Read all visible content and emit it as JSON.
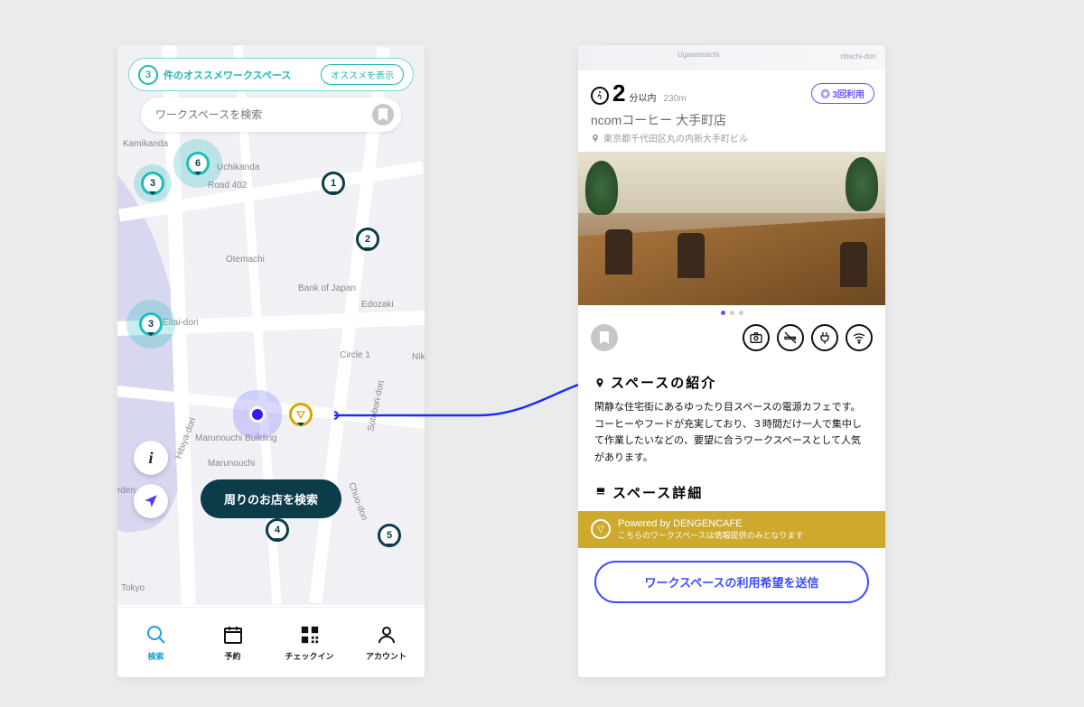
{
  "left": {
    "recommend": {
      "count": "3",
      "label": "件のオススメワークスペース",
      "show": "オススメを表示"
    },
    "search_placeholder": "ワークスペースを検索",
    "map_labels": {
      "uchikanda": "Uchikanda",
      "road402": "Road 402",
      "otemachi": "Otemachi",
      "bankjp": "Bank of Japan",
      "edozaki": "Edozaki",
      "eitai": "Eitai-dori",
      "circle1": "Circle 1",
      "marunouchi": "Marunouchi",
      "building": "Marunouchi Building",
      "chuo": "Chuo-dori",
      "hibiya": "Hibiya-dori",
      "nik": "Nik",
      "sotobori": "Sotobori-dori",
      "tokyo": "Tokyo",
      "garden": "rden",
      "ugawa": "Ugawamachi",
      "kanda": "Kamikanda"
    },
    "pins": {
      "p1": "3",
      "p2": "6",
      "p3": "1",
      "p4": "2",
      "p5": "3",
      "p6": "4",
      "p7": "5"
    },
    "search_around": "周りのお店を検索",
    "nav": {
      "search": "検索",
      "reserve": "予約",
      "checkin": "チェックイン",
      "account": "アカウント"
    }
  },
  "right": {
    "strip": {
      "ugawa": "Ugawamachi",
      "nbachi": "nbachi-dori"
    },
    "walk": {
      "num": "2",
      "unit": "分以内",
      "dist": "230m"
    },
    "usage_badge": "3回利用",
    "shop_name": "ncomコーヒー 大手町店",
    "address": "東京都千代田区丸の内新大手町ビル",
    "intro_title": "スペースの紹介",
    "intro_body": "閑静な住宅街にあるゆったり目スペースの電源カフェです。コーヒーやフードが充実しており、３時間だけ一人で集中して作業したいなどの、要望に合うワークスペースとして人気があります。",
    "detail_title": "スペース詳細",
    "powered": {
      "main": "Powered by DENGENCAFE",
      "sub": "こちらのワークスペースは情報提供のみとなります"
    },
    "send": "ワークスペースの利用希望を送信"
  }
}
